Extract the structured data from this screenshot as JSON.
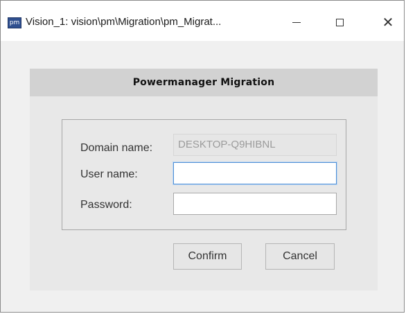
{
  "window": {
    "icon_text": "pm",
    "title": "Vision_1: vision\\pm\\Migration\\pm_Migrat...",
    "controls": {
      "minimize": "minimize-icon",
      "maximize": "maximize-icon",
      "close": "close-icon"
    }
  },
  "panel": {
    "title": "Powermanager Migration"
  },
  "form": {
    "domain_label": "Domain name:",
    "domain_value": "DESKTOP-Q9HIBNL",
    "user_label": "User name:",
    "user_value": "",
    "password_label": "Password:",
    "password_value": ""
  },
  "buttons": {
    "confirm": "Confirm",
    "cancel": "Cancel"
  },
  "colors": {
    "header_bg": "#d2d2d2",
    "panel_bg": "#e8e8e8",
    "focus_border": "#4f8fd6"
  }
}
